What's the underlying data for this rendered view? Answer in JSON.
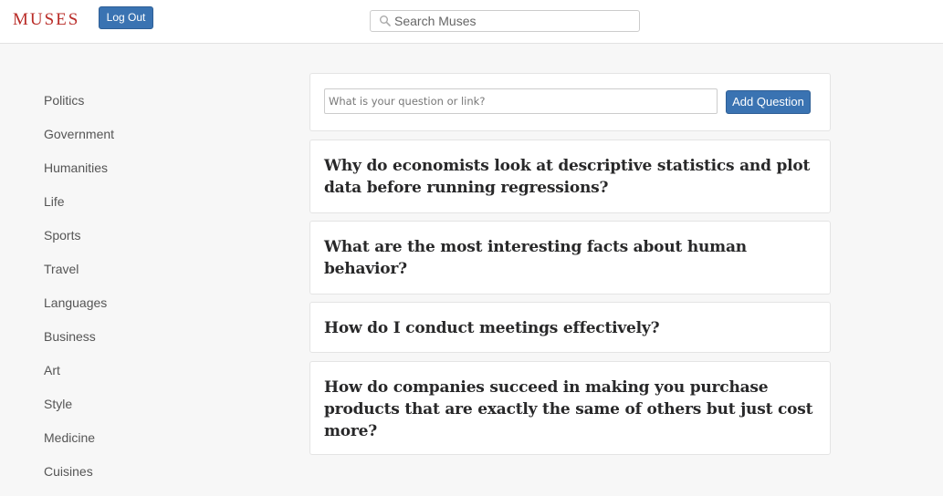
{
  "header": {
    "logo": "MUSES",
    "logout_label": "Log Out",
    "search": {
      "placeholder": "Search Muses",
      "icon": "search-icon"
    }
  },
  "sidebar": {
    "items": [
      {
        "label": "Politics"
      },
      {
        "label": "Government"
      },
      {
        "label": "Humanities"
      },
      {
        "label": "Life"
      },
      {
        "label": "Sports"
      },
      {
        "label": "Travel"
      },
      {
        "label": "Languages"
      },
      {
        "label": "Business"
      },
      {
        "label": "Art"
      },
      {
        "label": "Style"
      },
      {
        "label": "Medicine"
      },
      {
        "label": "Cuisines"
      }
    ]
  },
  "ask": {
    "placeholder": "What is your question or link?",
    "button_label": "Add Question"
  },
  "questions": [
    {
      "text": "Why do economists look at descriptive statistics and plot data before running regressions?"
    },
    {
      "text": "What are the most interesting facts about human behavior?"
    },
    {
      "text": "How do I conduct meetings effectively?"
    },
    {
      "text": "How do companies succeed in making you purchase products that are exactly the same of others but just cost more?"
    }
  ],
  "colors": {
    "brand": "#b92b27",
    "button": "#3a73b2",
    "background": "#f7f7f7"
  }
}
